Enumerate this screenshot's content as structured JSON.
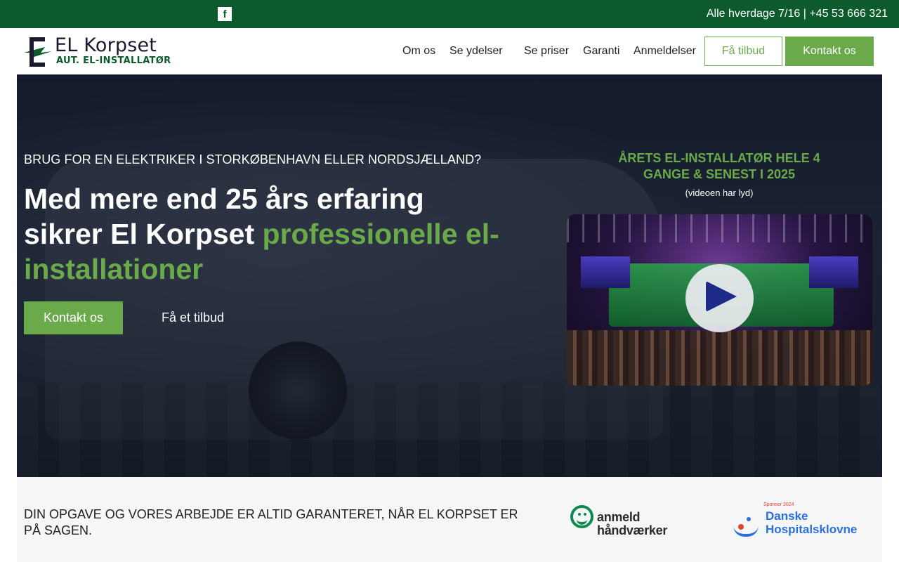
{
  "topbar": {
    "facebook_icon": "f",
    "contact": "Alle hverdage 7/16 | +45 53 666 321"
  },
  "header": {
    "logo_name": "EL Korpset",
    "logo_sub": "AUT. EL-INSTALLATØR",
    "nav": [
      "Om os",
      "Se ydelser",
      "Se priser",
      "Garanti",
      "Anmeldelser"
    ],
    "btn_quote": "Få tilbud",
    "btn_contact": "Kontakt os"
  },
  "hero": {
    "kicker": "BRUG FOR EN ELEKTRIKER I STORKØBENHAVN ELLER NORDSJÆLLAND?",
    "title_white": "Med mere end 25 års erfaring sikrer El Korpset ",
    "title_green": "professionelle el-installationer",
    "cta_primary": "Kontakt os",
    "cta_secondary": "Få et tilbud",
    "award_title": "ÅRETS EL-INSTALLATØR HELE 4 GANGE & SENEST I 2025",
    "award_note": "(videoen har lyd)"
  },
  "strip": {
    "text": "DIN OPGAVE OG VORES ARBEJDE ER ALTID GARANTERET, NÅR EL KORPSET ER PÅ SAGEN.",
    "anmeld_line1": "anmeld",
    "anmeld_line2": "håndværker",
    "hospital_sponsor": "Sponsor 2024",
    "hospital_line1": "Danske",
    "hospital_line2": "Hospitalsklovne"
  },
  "colors": {
    "brand_green_dark": "#0d5b2c",
    "accent_green": "#6aaa4a",
    "hero_overlay": "#0e1626"
  }
}
